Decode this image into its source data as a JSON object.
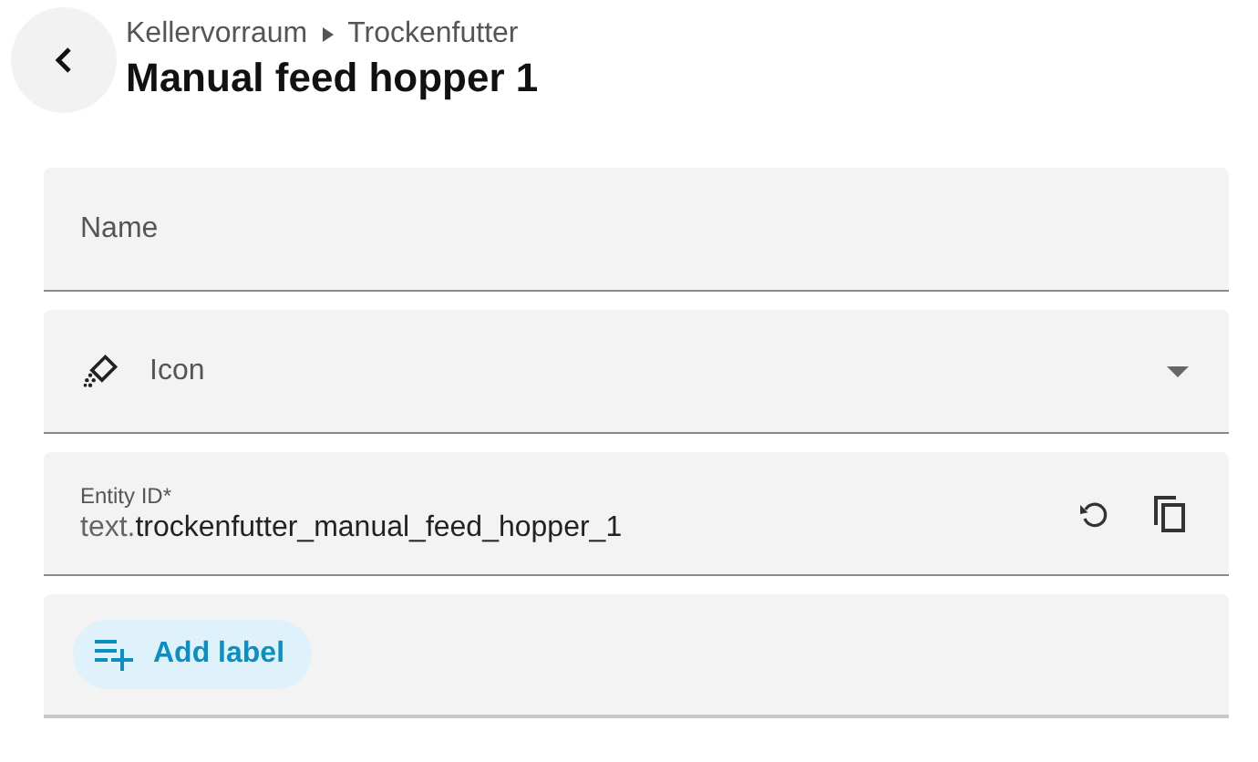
{
  "header": {
    "breadcrumb": [
      "Kellervorraum",
      "Trockenfutter"
    ],
    "title": "Manual feed hopper 1"
  },
  "fields": [
    {
      "kind": "text",
      "label": "Name"
    },
    {
      "kind": "icon_picker",
      "label": "Icon"
    },
    {
      "kind": "entity_id",
      "label": "Entity ID*",
      "prefix": "text.",
      "value": "trockenfutter_manual_feed_hopper_1"
    },
    {
      "kind": "labels",
      "button": "Add label"
    }
  ]
}
